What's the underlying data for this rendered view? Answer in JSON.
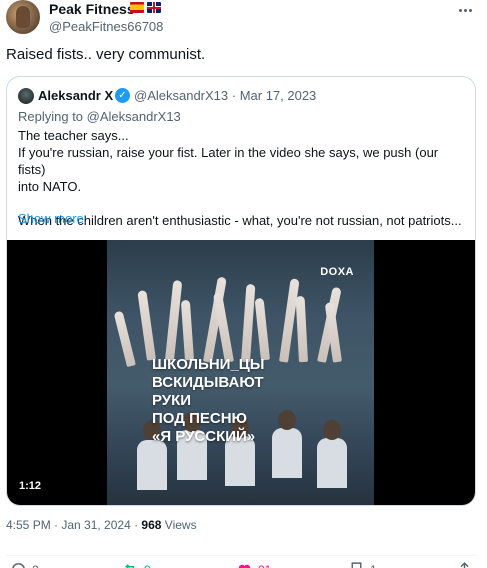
{
  "tweet": {
    "author_name": "Peak Fitness",
    "author_handle": "@PeakFitnes66708",
    "text": "Raised fists.. very communist.",
    "timestamp": "4:55 PM · Jan 31, 2024 · ",
    "views_count": "968",
    "views_label": " Views"
  },
  "quote": {
    "author_name": "Aleksandr X",
    "author_handle": "@AleksandrX13 · Mar 17, 2023",
    "replying_to": "Replying to @AleksandrX13",
    "line1": "The teacher says...",
    "line2": "If you're russian, raise your fist. Later in the video she says, we push (our fists)",
    "line3": "into NATO.",
    "line4": "When the children aren't enthusiastic - what, you're not russian, not patriots...",
    "show_more": "Show more"
  },
  "video": {
    "watermark": "DOXA",
    "caption_lines": [
      "ШКОЛЬНИ_ЦЫ",
      "ВСКИДЫВАЮТ",
      "РУКИ",
      "ПОД ПЕСНЮ",
      "«Я РУССКИЙ»"
    ],
    "duration": "1:12"
  },
  "actions": {
    "replies": "2",
    "reposts": "9",
    "likes": "21",
    "bookmarks": "1"
  },
  "colors": {
    "accent": "#1d9bf0",
    "repost": "#00ba7c",
    "like": "#f91880",
    "secondary_text": "#536471"
  },
  "icons": [
    "more-icon",
    "verified-icon",
    "reply-icon",
    "repost-icon",
    "like-icon",
    "bookmark-icon",
    "share-icon"
  ]
}
